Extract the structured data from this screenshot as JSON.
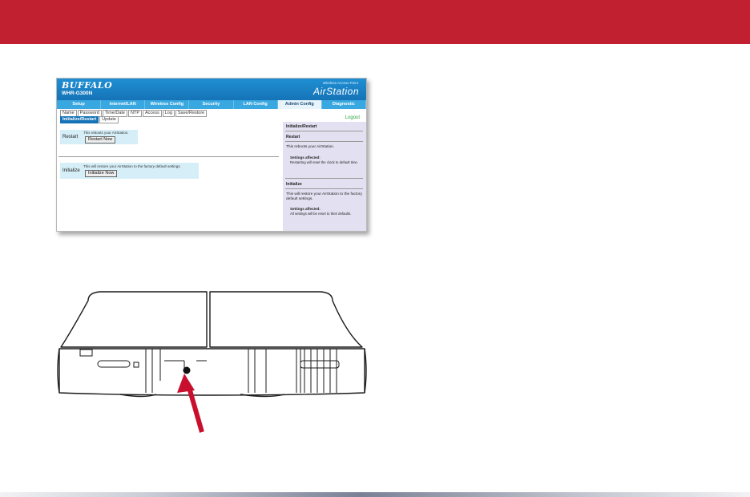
{
  "colors": {
    "banner": "#c0202f",
    "arrow": "#c8102e",
    "header": "#1673b7"
  },
  "screenshot": {
    "logo": "BUFFALO",
    "model": "WHR-G300N",
    "ap_label": "Wireless Access Point",
    "brand": "AirStation",
    "tabs": [
      "Setup",
      "Internet/LAN",
      "Wireless Config",
      "Security",
      "LAN Config",
      "Admin Config",
      "Diagnostic"
    ],
    "subnav": [
      "Name",
      "Password",
      "Time/Date",
      "NTP",
      "Access",
      "Log",
      "Save/Restore"
    ],
    "subnav2": [
      "Initialize/Restart",
      "Update"
    ],
    "logout": "Logout",
    "restart": {
      "label": "Restart",
      "text": "This reboots your AirStation.",
      "button": "Restart Now"
    },
    "initialize": {
      "label": "Initialize",
      "text": "This will restore your AirStation to the factory default settings.",
      "button": "Initialize Now"
    },
    "help": {
      "title": "Initialize/Restart",
      "restart_title": "Restart",
      "restart_text": "This reboots your AirStation.",
      "restart_affected_label": "Settings affected:",
      "restart_affected": "Restarting will reset the clock to default time.",
      "init_title": "Initialize",
      "init_text": "This will restore your AirStation to the factory default settings.",
      "init_affected_label": "Settings affected:",
      "init_affected": "All settings will be reset to their defaults."
    }
  },
  "device_illustration": {
    "subject": "router-back-panel",
    "arrow_target": "reset-button-hole"
  }
}
